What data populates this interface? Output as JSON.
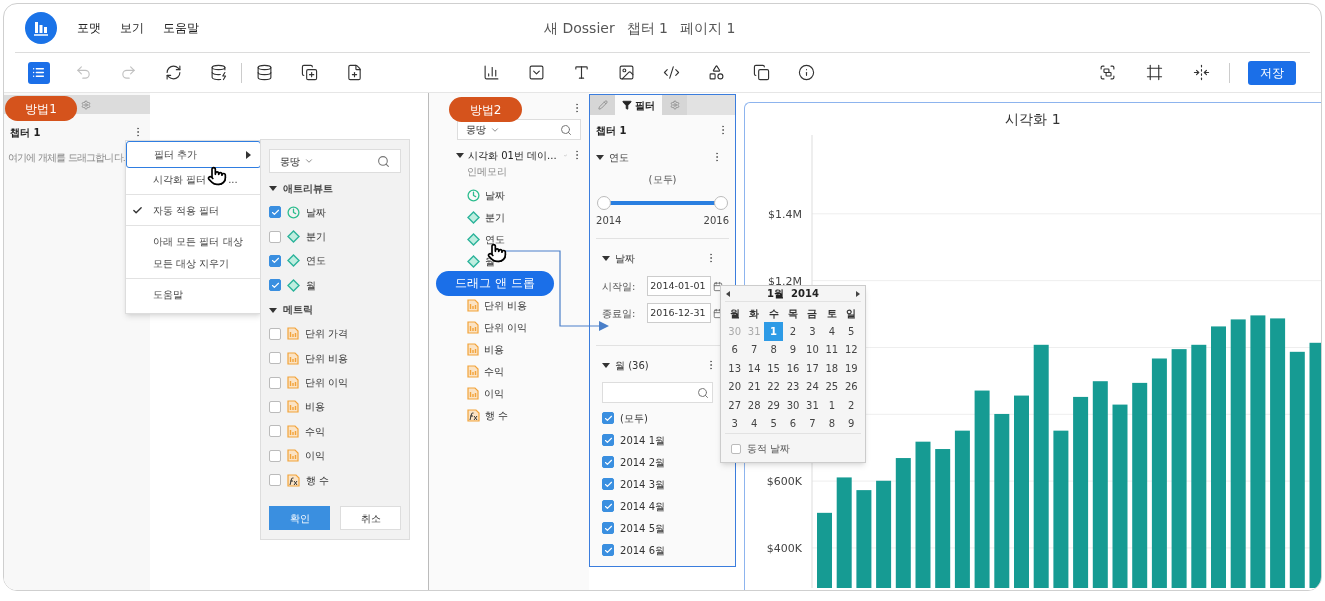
{
  "header": {
    "menu": [
      {
        "label": "포맷"
      },
      {
        "label": "보기"
      },
      {
        "label": "도움말"
      }
    ],
    "title": [
      "새 Dossier",
      "챕터 1",
      "페이지 1"
    ]
  },
  "toolbar": {
    "left": [
      {
        "selected": true,
        "disabled": false
      },
      {
        "selected": false,
        "disabled": true
      },
      {
        "selected": false,
        "disabled": true
      },
      {
        "selected": false,
        "disabled": false
      },
      {
        "selected": false,
        "disabled": false
      }
    ],
    "left2": [
      {
        "selected": false,
        "disabled": false
      },
      {
        "selected": false,
        "disabled": false
      },
      {
        "selected": false,
        "disabled": false
      }
    ],
    "insert": [
      {
        "selected": false,
        "disabled": false
      },
      {
        "selected": false,
        "disabled": false
      },
      {
        "selected": false,
        "disabled": false
      },
      {
        "selected": false,
        "disabled": false
      },
      {
        "selected": false,
        "disabled": false
      },
      {
        "selected": false,
        "disabled": false
      },
      {
        "selected": false,
        "disabled": false
      },
      {
        "selected": false,
        "disabled": false
      }
    ],
    "right": [
      {
        "selected": false,
        "disabled": false
      },
      {
        "selected": false,
        "disabled": false
      },
      {
        "selected": false,
        "disabled": false
      }
    ],
    "save": "저장"
  },
  "badges": [
    "방법1",
    "방법2"
  ],
  "panel1": {
    "chapter": "챕터 1",
    "hint": "여기에 개체를 드래그합니다."
  },
  "context_menu": [
    [
      {
        "label": "필터 추가",
        "selected": true,
        "checked": false,
        "submenu": true
      },
      {
        "label": "시각화 필터",
        "suffix": "...",
        "selected": false,
        "checked": false,
        "submenu": false
      }
    ],
    [
      {
        "label": "자동 적용 필터",
        "selected": false,
        "checked": true,
        "submenu": false
      }
    ],
    [
      {
        "label": "아래 모든 필터 대상",
        "selected": false,
        "checked": false,
        "submenu": false
      },
      {
        "label": "모든 대상 지우기",
        "selected": false,
        "checked": false,
        "submenu": false
      }
    ],
    [
      {
        "label": "도움말",
        "selected": false,
        "checked": false,
        "submenu": false
      }
    ]
  ],
  "add_filter_panel": {
    "dataset": "몽땅",
    "sections": [
      {
        "label": "애트리뷰트",
        "expanded": true,
        "items": [
          {
            "label": "날짜",
            "kind": "date",
            "checked": true
          },
          {
            "label": "분기",
            "kind": "attribute",
            "checked": false
          },
          {
            "label": "연도",
            "kind": "attribute",
            "checked": true
          },
          {
            "label": "월",
            "kind": "attribute",
            "checked": true
          }
        ]
      },
      {
        "label": "메트릭",
        "expanded": true,
        "items": [
          {
            "label": "단위 가격",
            "kind": "metric",
            "checked": false
          },
          {
            "label": "단위 비용",
            "kind": "metric",
            "checked": false
          },
          {
            "label": "단위 이익",
            "kind": "metric",
            "checked": false
          },
          {
            "label": "비용",
            "kind": "metric",
            "checked": false
          },
          {
            "label": "수익",
            "kind": "metric",
            "checked": false
          },
          {
            "label": "이익",
            "kind": "metric",
            "checked": false
          },
          {
            "label": "행 수",
            "kind": "formula",
            "checked": false
          }
        ]
      }
    ],
    "buttons": [
      {
        "label": "확인",
        "primary": true
      },
      {
        "label": "취소",
        "primary": false
      }
    ]
  },
  "dataset_panel": {
    "dataset": "몽땅",
    "name": "시각화 01번 데이...",
    "mode": "인메모리",
    "expanded": true,
    "items": [
      {
        "label": "날짜",
        "kind": "date"
      },
      {
        "label": "분기",
        "kind": "attribute"
      },
      {
        "label": "연도",
        "kind": "attribute"
      },
      {
        "label": "월",
        "kind": "attribute"
      }
    ],
    "drag_badge": "드래그 앤 드롭",
    "items_below": [
      {
        "label": "단위 비용",
        "kind": "metric"
      },
      {
        "label": "단위 이익",
        "kind": "metric"
      },
      {
        "label": "비용",
        "kind": "metric"
      },
      {
        "label": "수익",
        "kind": "metric"
      },
      {
        "label": "이익",
        "kind": "metric"
      },
      {
        "label": "행 수",
        "kind": "formula"
      }
    ]
  },
  "filter_panel": {
    "tabs": [
      {
        "selected": false
      },
      {
        "label": "필터",
        "selected": true
      },
      {
        "selected": false
      }
    ],
    "chapter": "챕터 1",
    "filters": [
      {
        "kind": "slider",
        "label": "연도",
        "expanded": true,
        "reading": "(모두)",
        "level": 1,
        "min_label": "2014",
        "max_label": "2016"
      },
      {
        "kind": "date",
        "label": "날짜",
        "expanded": true,
        "start_label": "시작일:",
        "start": "2014-01-01",
        "end_label": "종료일:",
        "end": "2016-12-31"
      },
      {
        "kind": "list",
        "label": "월 (36)",
        "expanded": true,
        "options": [
          {
            "label": "(모두)",
            "checked": true
          },
          {
            "label": "2014 1월",
            "checked": true
          },
          {
            "label": "2014 2월",
            "checked": true
          },
          {
            "label": "2014 3월",
            "checked": true
          },
          {
            "label": "2014 4월",
            "checked": true
          },
          {
            "label": "2014 5월",
            "checked": true
          },
          {
            "label": "2014 6월",
            "checked": true
          }
        ]
      }
    ]
  },
  "calendar": {
    "month": "1월  2014",
    "weekdays": [
      "월",
      "화",
      "수",
      "목",
      "금",
      "토",
      "일"
    ],
    "weeks": [
      [
        {
          "day": "30",
          "muted": true,
          "selected": false
        },
        {
          "day": "31",
          "muted": true,
          "selected": false
        },
        {
          "day": "1",
          "muted": false,
          "selected": true
        },
        {
          "day": "2",
          "muted": false,
          "selected": false
        },
        {
          "day": "3",
          "muted": false,
          "selected": false
        },
        {
          "day": "4",
          "muted": false,
          "selected": false
        },
        {
          "day": "5",
          "muted": false,
          "selected": false
        }
      ],
      [
        {
          "day": "6",
          "muted": false,
          "selected": false
        },
        {
          "day": "7",
          "muted": false,
          "selected": false
        },
        {
          "day": "8",
          "muted": false,
          "selected": false
        },
        {
          "day": "9",
          "muted": false,
          "selected": false
        },
        {
          "day": "10",
          "muted": false,
          "selected": false
        },
        {
          "day": "11",
          "muted": false,
          "selected": false
        },
        {
          "day": "12",
          "muted": false,
          "selected": false
        }
      ],
      [
        {
          "day": "13",
          "muted": false,
          "selected": false
        },
        {
          "day": "14",
          "muted": false,
          "selected": false
        },
        {
          "day": "15",
          "muted": false,
          "selected": false
        },
        {
          "day": "16",
          "muted": false,
          "selected": false
        },
        {
          "day": "17",
          "muted": false,
          "selected": false
        },
        {
          "day": "18",
          "muted": false,
          "selected": false
        },
        {
          "day": "19",
          "muted": false,
          "selected": false
        }
      ],
      [
        {
          "day": "20",
          "muted": false,
          "selected": false
        },
        {
          "day": "21",
          "muted": false,
          "selected": false
        },
        {
          "day": "22",
          "muted": false,
          "selected": false
        },
        {
          "day": "23",
          "muted": false,
          "selected": false
        },
        {
          "day": "24",
          "muted": false,
          "selected": false
        },
        {
          "day": "25",
          "muted": false,
          "selected": false
        },
        {
          "day": "26",
          "muted": false,
          "selected": false
        }
      ],
      [
        {
          "day": "27",
          "muted": false,
          "selected": false
        },
        {
          "day": "28",
          "muted": false,
          "selected": false
        },
        {
          "day": "29",
          "muted": false,
          "selected": false
        },
        {
          "day": "30",
          "muted": false,
          "selected": false
        },
        {
          "day": "31",
          "muted": false,
          "selected": false
        },
        {
          "day": "1",
          "muted": false,
          "selected": false
        },
        {
          "day": "2",
          "muted": false,
          "selected": false
        }
      ],
      [
        {
          "day": "3",
          "muted": false,
          "selected": false
        },
        {
          "day": "4",
          "muted": false,
          "selected": false
        },
        {
          "day": "5",
          "muted": false,
          "selected": false
        },
        {
          "day": "6",
          "muted": false,
          "selected": false
        },
        {
          "day": "7",
          "muted": false,
          "selected": false
        },
        {
          "day": "8",
          "muted": false,
          "selected": false
        },
        {
          "day": "9",
          "muted": false,
          "selected": false
        }
      ]
    ],
    "dynamic_label": "동적 날짜",
    "dynamic_checked": false
  },
  "chart": {
    "title": "시각화 1",
    "chart_data": {
      "type": "bar",
      "grid": true,
      "ylim": [
        280000,
        1636000
      ],
      "yticks": [
        {
          "value": 400000,
          "label": "$400K"
        },
        {
          "value": 600000,
          "label": "$600K"
        },
        {
          "value": 1200000,
          "label": "$1.2M"
        },
        {
          "value": 1400000,
          "label": "$1.4M"
        }
      ],
      "series": [
        {
          "color": "#169b93",
          "values": [
            505000,
            611000,
            573000,
            601000,
            669000,
            718000,
            696000,
            751000,
            871000,
            801000,
            856000,
            1008000,
            751000,
            852000,
            899000,
            829000,
            894000,
            967000,
            995000,
            1008000,
            1063000,
            1084000,
            1096000,
            1087000,
            987000,
            1014000
          ]
        }
      ]
    }
  }
}
